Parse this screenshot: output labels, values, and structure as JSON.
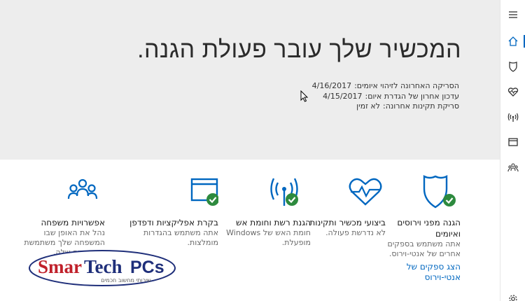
{
  "hero": {
    "title": "המכשיר שלך עובר פעולת הגנה.",
    "meta": [
      {
        "label": "הסריקה האחרונה לזיהוי איומים:",
        "value": "4/16/2017"
      },
      {
        "label": "עדכון אחרון של הגדרת איום:",
        "value": "4/15/2017"
      },
      {
        "label": "סריקת תקינות אחרונה:",
        "value": "לא זמין"
      }
    ]
  },
  "tiles": [
    {
      "title": "הגנה מפני וירוסים ואיומים",
      "desc": "אתה משתמש בספקים אחרים של אנטי-וירוס.",
      "link": "הצג ספקים של אנטי-וירוס"
    },
    {
      "title": "ביצועי מכשיר ותקינות",
      "desc": "לא נדרשת פעולה."
    },
    {
      "title": "הגנת רשת וחומת אש",
      "desc": "חומת האש של Windows מופעלת."
    },
    {
      "title": "בקרת אפליקציות ודפדפן",
      "desc": "אתה משתמש בהגדרות מומלצות."
    },
    {
      "title": "אפשרויות משפחה",
      "desc": "נהל את האופן שבו המשפחה שלך משתמשת במכשירים שלה."
    }
  ],
  "logo": {
    "brand": "SmarTech PCs",
    "tagline": "שירותי מחשוב חכמים"
  },
  "colors": {
    "accent": "#0067c0",
    "check": "#2d8a3e",
    "hero_bg": "#ededed"
  },
  "rail": {
    "icons": [
      "hamburger-icon",
      "home-icon",
      "shield-icon",
      "heart-pulse-icon",
      "antenna-icon",
      "browser-window-icon",
      "family-icon",
      "settings-gear-icon"
    ]
  }
}
